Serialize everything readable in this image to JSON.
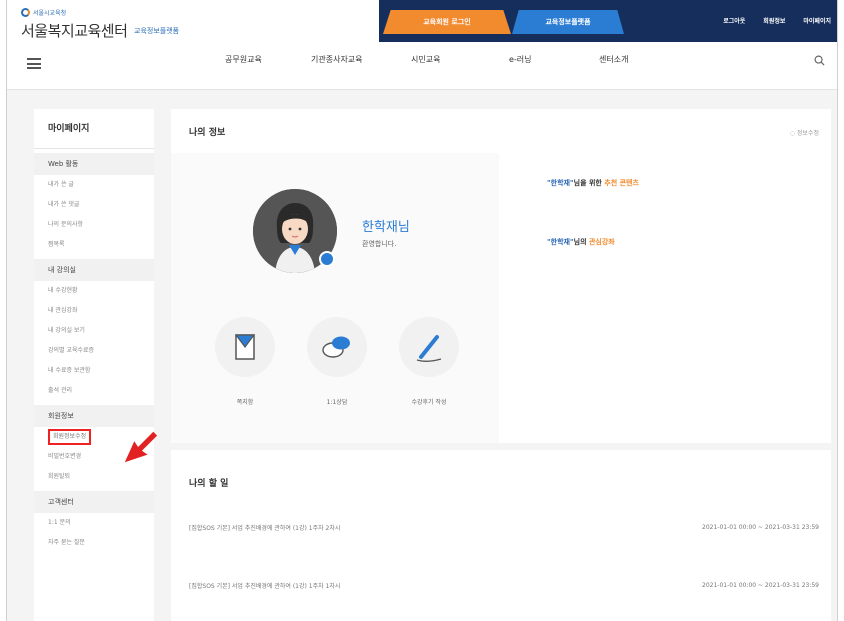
{
  "header": {
    "logo_small": "서울시교육청",
    "logo_main": "서울복지교육센터",
    "logo_sub": "교육정보플랫폼",
    "tab_orange": "교육회원 로그인",
    "tab_blue": "교육정보플랫폼",
    "util_links": [
      "로그아웃",
      "회원정보",
      "마이페이지"
    ],
    "gnb": [
      "공무원교육",
      "기관종사자교육",
      "시민교육",
      "e-러닝",
      "센터소개"
    ]
  },
  "sidebar": {
    "title": "마이페이지",
    "groups": [
      {
        "label": "Web 활동",
        "items": [
          "내가 쓴 글",
          "내가 쓴 댓글",
          "나의 문의사항",
          "찜목록"
        ]
      },
      {
        "label": "내 강의실",
        "items": [
          "내 수강현황",
          "내 관심강좌",
          "내 강의실 보기",
          "강의별 교육수료증",
          "내 수료증 보관함",
          "출석 관리"
        ]
      },
      {
        "label": "회원정보",
        "items": [
          "회원정보수정",
          "비밀번호변경",
          "회원탈퇴"
        ]
      },
      {
        "label": "고객센터",
        "items": [
          "1:1 문의",
          "자주 묻는 질문"
        ]
      }
    ],
    "highlighted_item": "회원정보수정"
  },
  "myinfo": {
    "title": "나의 정보",
    "edit_link": "정보수정",
    "name": "한학재님",
    "greeting": "환영합니다.",
    "quick_links": [
      "쪽지함",
      "1:1상담",
      "수강후기 작성"
    ],
    "recommend_prefix": "\"한학재\"",
    "recommend_mid": "님을 위한 ",
    "recommend_accent": "추천 콘텐츠",
    "interest_prefix": "\"한학재\"",
    "interest_mid": "님의 ",
    "interest_accent": "관심강좌"
  },
  "todo": {
    "title": "나의 할 일",
    "rows": [
      {
        "label": "[집합SOS 기본] 서업 추진배경에 관하여 (1강) 1주차 2차시",
        "date": "2021-01-01 00:00 ~ 2021-03-31 23:59"
      },
      {
        "label": "[집합SOS 기본] 서업 추진배경에 관하여 (1강) 1주차 1차시",
        "date": "2021-01-01 00:00 ~ 2021-03-31 23:59"
      }
    ]
  },
  "colors": {
    "navy": "#152e5c",
    "orange": "#f28a2e",
    "blue": "#2b7cd3",
    "annotation_red": "#e22222"
  }
}
